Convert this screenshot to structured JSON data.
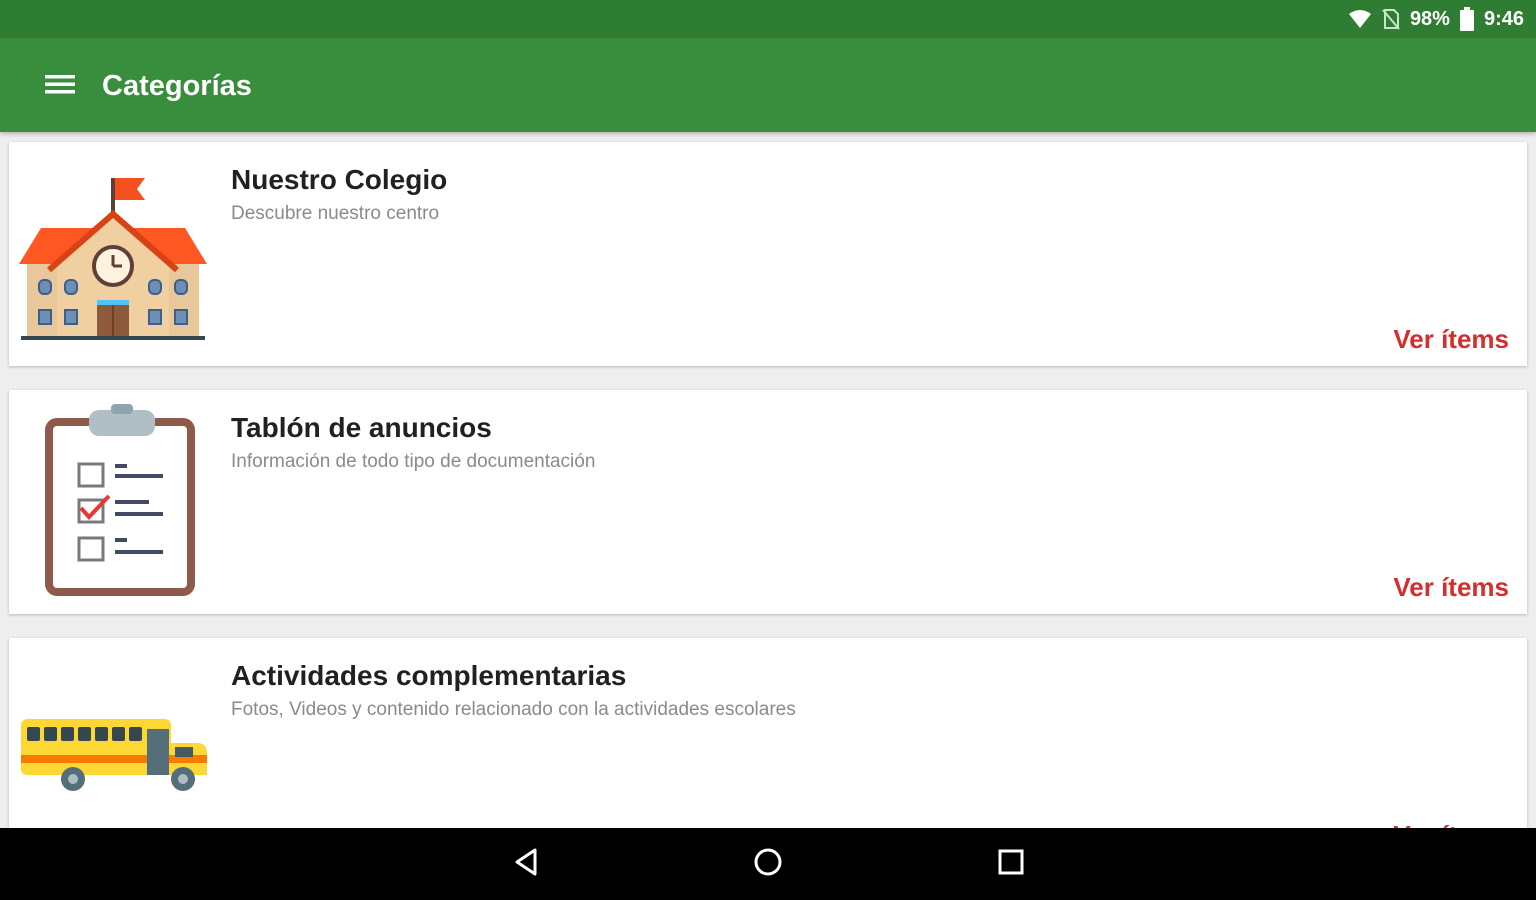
{
  "status_bar": {
    "battery": "98%",
    "time": "9:46",
    "icons": [
      "wifi-icon",
      "no-sim-icon",
      "battery-icon"
    ]
  },
  "app_bar": {
    "title": "Categorías",
    "menu_icon": "hamburger-menu-icon"
  },
  "categories": [
    {
      "title": "Nuestro Colegio",
      "subtitle": "Descubre nuestro centro",
      "action": "Ver ítems",
      "icon": "school-building-icon"
    },
    {
      "title": "Tablón de anuncios",
      "subtitle": "Información de todo tipo de documentación",
      "action": "Ver ítems",
      "icon": "clipboard-checklist-icon"
    },
    {
      "title": "Actividades complementarias",
      "subtitle": "Fotos, Videos y contenido relacionado con la actividades escolares",
      "action": "Ver ítems",
      "icon": "school-bus-icon"
    }
  ],
  "nav_bar": {
    "icons": [
      "back-icon",
      "home-icon",
      "recents-icon"
    ]
  },
  "colors": {
    "status_bar": "#2e7d32",
    "app_bar": "#388e3c",
    "accent": "#d32f2f",
    "background": "#eeeeee"
  }
}
